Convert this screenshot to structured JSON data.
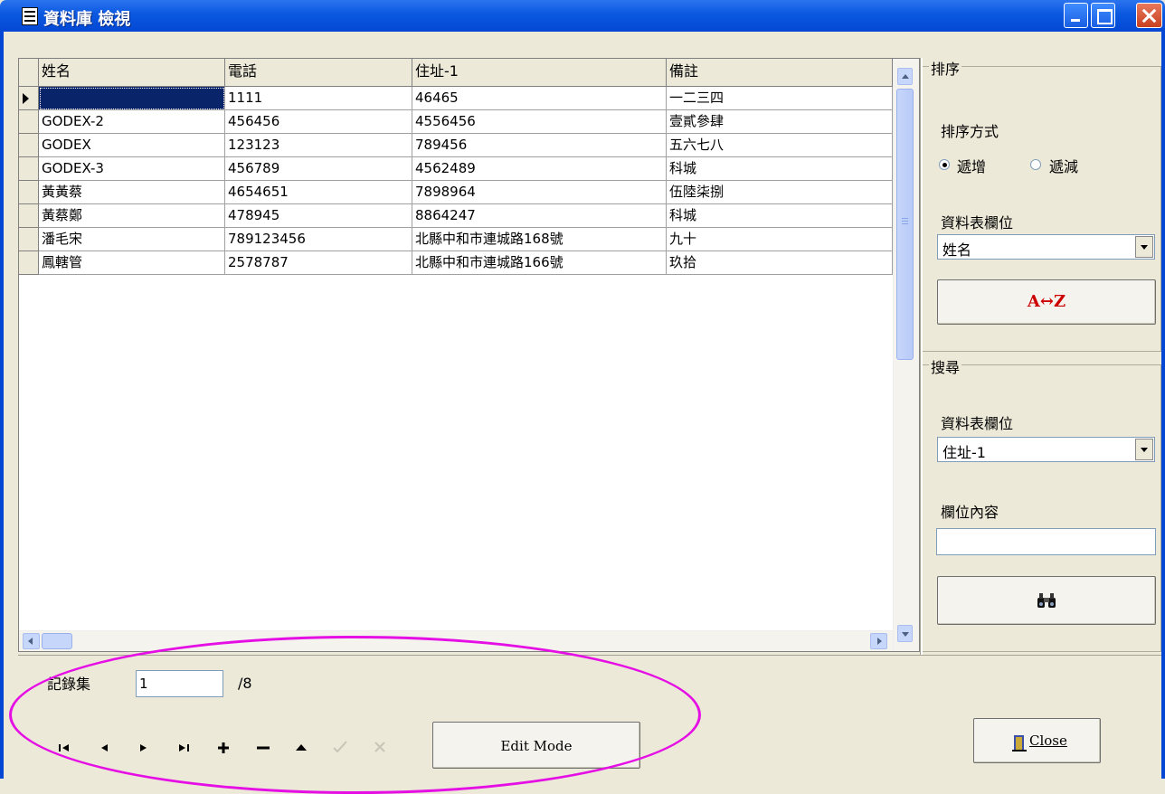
{
  "window": {
    "title": "資料庫 檢視"
  },
  "grid": {
    "columns": [
      "姓名",
      "電話",
      "住址-1",
      "備註"
    ],
    "rows": [
      [
        "",
        "1111",
        "46465",
        "一二三四"
      ],
      [
        "GODEX-2",
        "456456",
        "4556456",
        "壹貳參肆"
      ],
      [
        "GODEX",
        "123123",
        "789456",
        "五六七八"
      ],
      [
        "GODEX-3",
        "456789",
        "4562489",
        "科城"
      ],
      [
        "黃黃蔡",
        "4654651",
        "7898964",
        "伍陸柒捌"
      ],
      [
        "黃蔡鄭",
        "478945",
        "8864247",
        "科城"
      ],
      [
        "潘毛宋",
        "789123456",
        "北縣中和市連城路168號",
        "九十"
      ],
      [
        "鳳轄管",
        "2578787",
        "北縣中和市連城路166號",
        "玖拾"
      ]
    ]
  },
  "sort": {
    "group_label": "排序",
    "method_label": "排序方式",
    "asc_label": "遞增",
    "desc_label": "遞減",
    "selected": "asc",
    "field_label": "資料表欄位",
    "field_value": "姓名",
    "button_label": "A↔Z"
  },
  "search": {
    "group_label": "搜尋",
    "field_label": "資料表欄位",
    "field_value": "住址-1",
    "content_label": "欄位內容",
    "content_value": "",
    "button_icon": "binoculars-icon"
  },
  "record": {
    "label": "記錄集",
    "current": "1",
    "total": "/8"
  },
  "nav": {
    "first": "first-record-icon",
    "prev": "prev-record-icon",
    "next": "next-record-icon",
    "last": "last-record-icon",
    "insert": "insert-record-icon",
    "delete": "delete-record-icon",
    "edit": "edit-record-icon",
    "post": "post-record-icon",
    "cancel": "cancel-record-icon",
    "edit_mode_label": "Edit Mode"
  },
  "close_button": {
    "label": "Close"
  },
  "colors": {
    "title_bar": "#0a58e0",
    "sort_letters": "#cc0000",
    "highlight": "#e50ee5",
    "selection": "#0a246a"
  }
}
